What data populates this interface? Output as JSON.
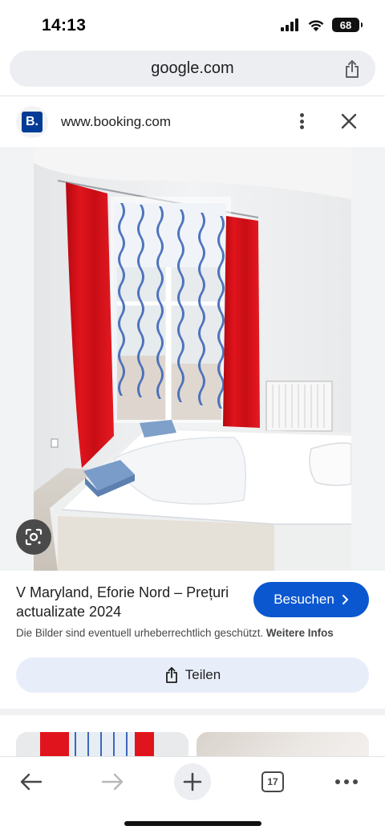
{
  "status": {
    "time": "14:13",
    "battery": "68"
  },
  "browser": {
    "url": "google.com"
  },
  "site": {
    "logo_letter": "B.",
    "domain": "www.booking.com"
  },
  "result": {
    "title": "V Maryland, Eforie Nord – Prețuri actualizate 2024",
    "visit_label": "Besuchen",
    "copyright_text": "Die Bilder sind eventuell urheberrechtlich geschützt.",
    "more_info_label": "Weitere Infos",
    "share_label": "Teilen"
  },
  "nav": {
    "tab_count": "17"
  },
  "colors": {
    "accent": "#0b57d0",
    "booking_blue": "#003b95",
    "curtain_red": "#e0141c"
  },
  "icons": [
    "signal-icon",
    "wifi-icon",
    "battery-icon",
    "share-icon",
    "more-vert-icon",
    "close-icon",
    "lens-icon",
    "chevron-right-icon",
    "back-icon",
    "forward-icon",
    "plus-icon",
    "tabs-icon",
    "more-horiz-icon"
  ]
}
